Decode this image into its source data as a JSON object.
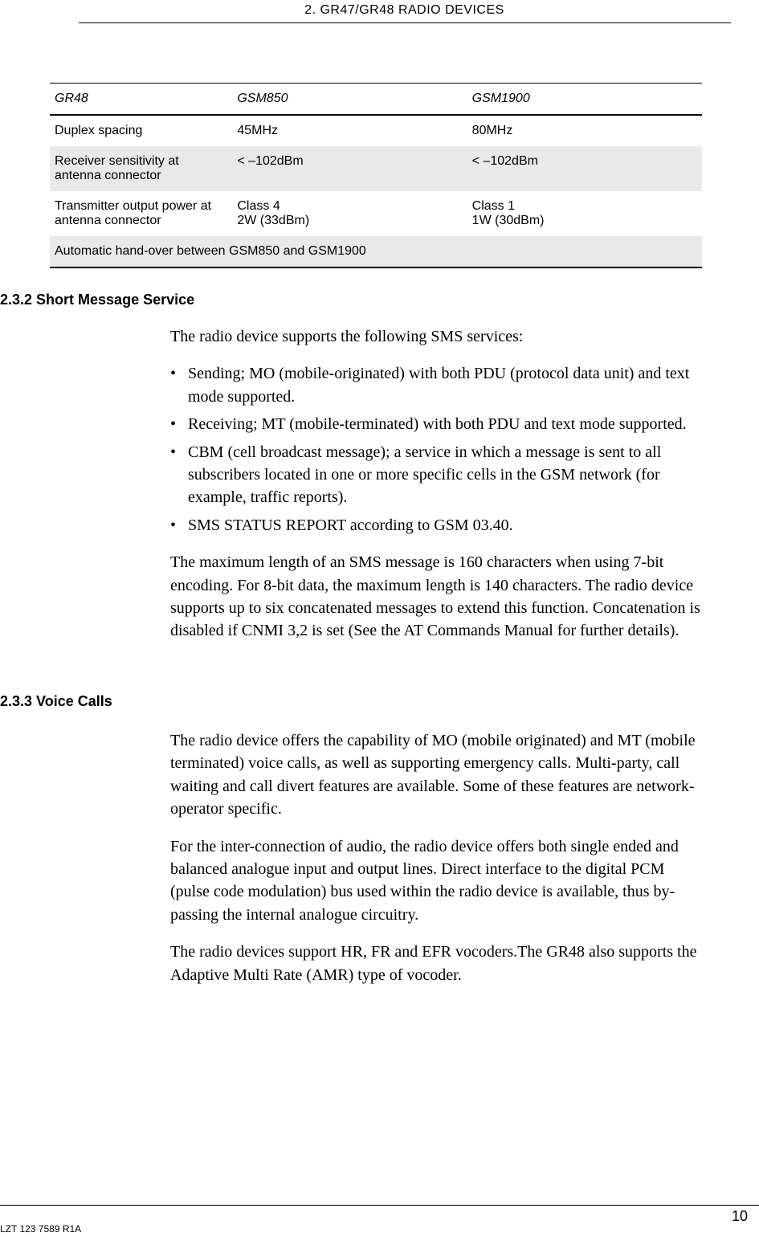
{
  "running_head": "2. GR47/GR48 RADIO DEVICES",
  "table": {
    "head": {
      "c0": "GR48",
      "c1": "GSM850",
      "c2": "GSM1900"
    },
    "rows": [
      {
        "c0": "Duplex spacing",
        "c1": "45MHz",
        "c2": "80MHz"
      },
      {
        "c0": "Receiver sensitivity at antenna connector",
        "c1": "< –102dBm",
        "c2": "< –102dBm"
      },
      {
        "c0": "Transmitter output power at antenna connector",
        "c1": "Class 4\n2W (33dBm)",
        "c2": "Class 1\n1W (30dBm)"
      },
      {
        "c0": "Automatic hand-over between GSM850 and GSM1900",
        "c1": "",
        "c2": ""
      }
    ]
  },
  "section232": {
    "heading": "2.3.2 Short Message Service",
    "intro": "The radio device supports the following SMS services:",
    "bullets": [
      "Sending; MO (mobile-originated) with both PDU (protocol data unit) and text mode supported.",
      "Receiving; MT (mobile-terminated) with both PDU and text mode supported.",
      "CBM (cell broadcast message); a service in which a message is sent to all subscribers located in one or more specific cells in the GSM network (for example, traffic reports).",
      "SMS STATUS REPORT according to GSM 03.40."
    ],
    "para2": "The maximum length of an SMS message is 160 characters when using 7-bit encoding. For 8-bit data, the maximum length is 140 characters. The radio device supports up to six concatenated messages to extend this function. Concatenation is disabled if CNMI 3,2 is set (See the AT Commands Manual for further details)."
  },
  "section233": {
    "heading": "2.3.3 Voice Calls",
    "para1": "The radio device offers the capability of MO (mobile originated) and MT (mobile terminated) voice calls, as well as supporting emergency calls. Multi-party, call waiting and call divert features are available. Some of these features are network-operator specific.",
    "para2": "For the inter-connection of audio, the radio device offers both single ended and balanced analogue input and output lines. Direct interface to the digital PCM (pulse code modulation) bus used within the radio device is available, thus by-passing the internal analogue circuitry.",
    "para3": "The radio devices support HR, FR and EFR vocoders.The GR48 also supports the Adaptive Multi Rate (AMR) type of vocoder."
  },
  "footer": {
    "doc_id": "LZT 123 7589 R1A",
    "page_no": "10"
  }
}
